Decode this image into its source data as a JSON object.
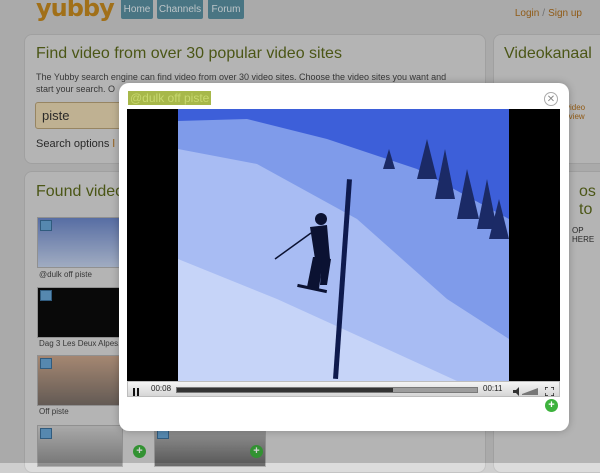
{
  "header": {
    "logo": "yubby",
    "nav": [
      {
        "label": "Home"
      },
      {
        "label": "Channels"
      },
      {
        "label": "Forum"
      }
    ],
    "login": "Login",
    "separator": "/",
    "signup": "Sign up"
  },
  "search_panel": {
    "title": "Find video from over 30 popular video sites",
    "description_line1": "The Yubby search engine can find video from over 30 video sites. Choose the video sites you want and",
    "description_line2": "start your search. O",
    "query": "piste",
    "options_label": "Search options",
    "options_more": "l"
  },
  "right_panel": {
    "title": "Videokanaal",
    "fragment1": "video",
    "fragment2": "rview",
    "fragment3": "os to",
    "fragment4": "OP HERE"
  },
  "found_panel": {
    "title": "Found video",
    "items": [
      {
        "caption": "@dulk off piste"
      },
      {
        "caption": "Dag 3 Les Deux Alpes..."
      },
      {
        "caption": "Off piste"
      },
      {
        "caption": ""
      }
    ]
  },
  "modal": {
    "title": "@dulk off piste",
    "close_icon": "close-icon",
    "player": {
      "current_time": "00:08",
      "duration": "00:11",
      "progress": 0.72,
      "pause_icon": "pause-icon",
      "volume_icon": "volume-icon",
      "fullscreen_icon": "fullscreen-icon"
    },
    "add_icon": "plus-icon"
  },
  "colors": {
    "accent_orange": "#c5891f",
    "nav_blue": "#5a8fa0",
    "title_green": "#5c6a1c",
    "add_green": "#3db23d"
  }
}
